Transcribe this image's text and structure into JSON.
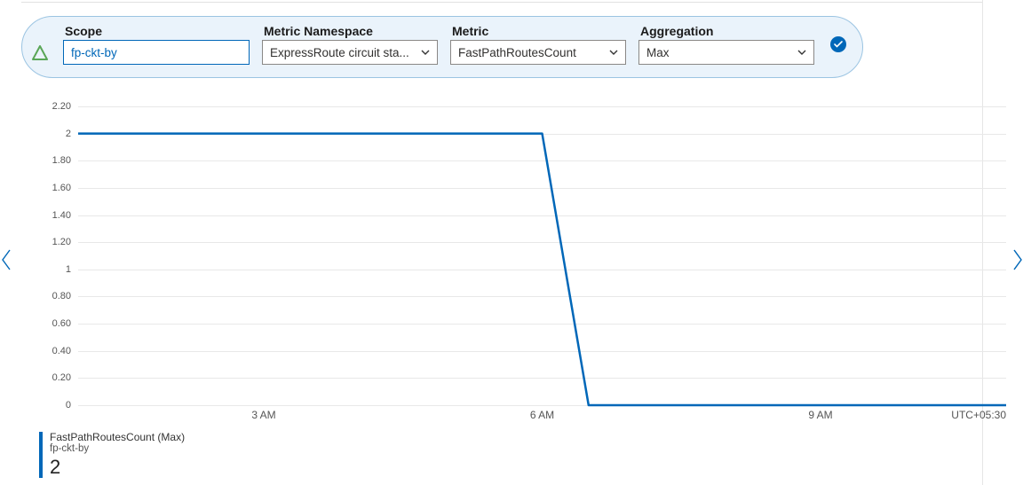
{
  "filters": {
    "scope": {
      "label": "Scope",
      "value": "fp-ckt-by"
    },
    "namespace": {
      "label": "Metric Namespace",
      "value": "ExpressRoute circuit sta..."
    },
    "metric": {
      "label": "Metric",
      "value": "FastPathRoutesCount"
    },
    "aggregation": {
      "label": "Aggregation",
      "value": "Max"
    }
  },
  "legend": {
    "title": "FastPathRoutesCount (Max)",
    "subtitle": "fp-ckt-by",
    "value": "2"
  },
  "axis": {
    "timezone": "UTC+05:30"
  },
  "chart_data": {
    "type": "line",
    "title": "FastPathRoutesCount (Max)",
    "xlabel": "",
    "ylabel": "",
    "ylim": [
      0,
      2.2
    ],
    "y_ticks": [
      0,
      0.2,
      0.4,
      0.6,
      0.8,
      1,
      1.2,
      1.4,
      1.6,
      1.8,
      2,
      2.2
    ],
    "x_ticks": [
      "3 AM",
      "6 AM",
      "9 AM"
    ],
    "series": [
      {
        "name": "FastPathRoutesCount (Max)",
        "color": "#0067b8",
        "x": [
          "1:00",
          "2:00",
          "3:00",
          "4:00",
          "5:00",
          "6:00",
          "6:30",
          "7:00",
          "8:00",
          "9:00",
          "10:00",
          "11:00"
        ],
        "values": [
          2,
          2,
          2,
          2,
          2,
          2,
          0,
          0,
          0,
          0,
          0,
          0
        ]
      }
    ]
  }
}
